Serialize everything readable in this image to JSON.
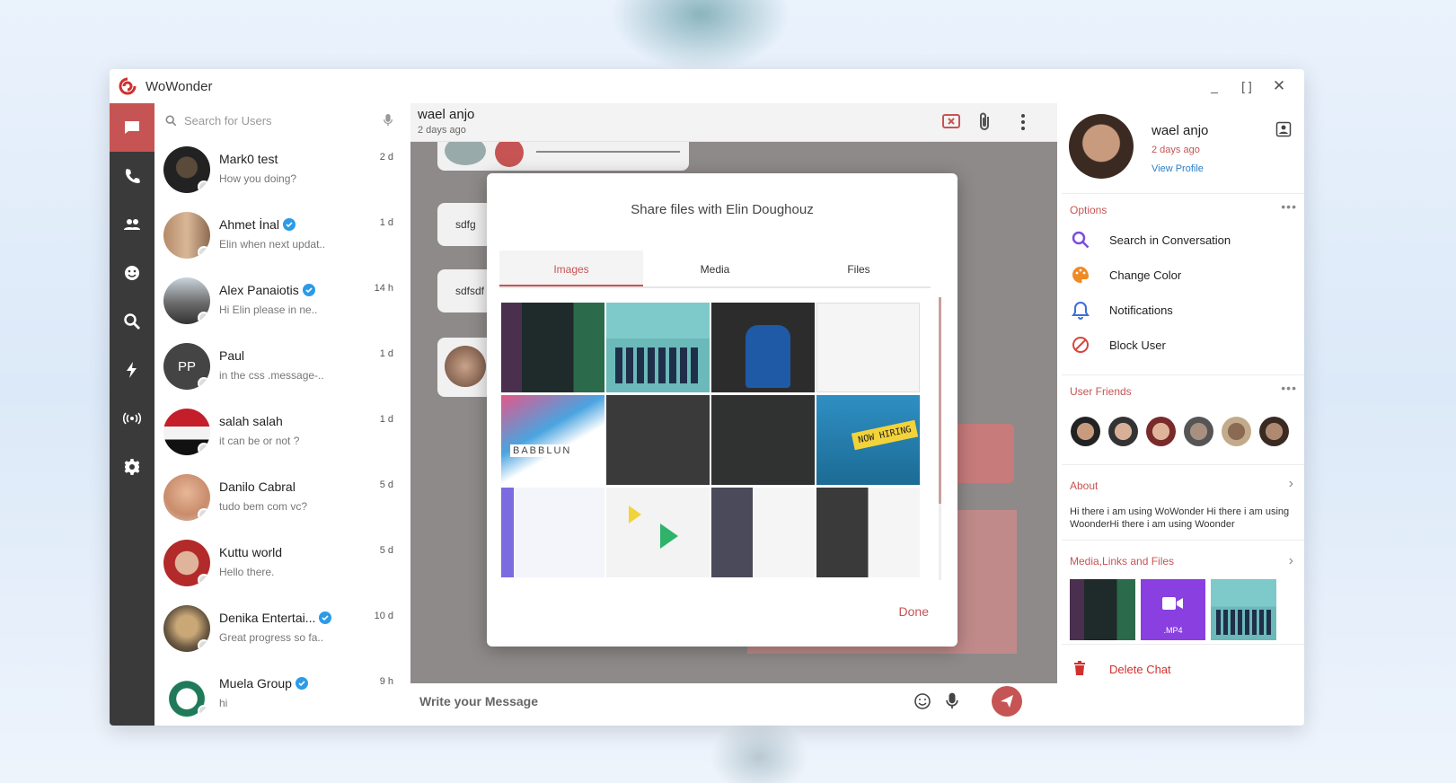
{
  "window": {
    "title": "WoWonder"
  },
  "sidebar_rail": {
    "items": [
      "chats",
      "calls",
      "groups",
      "stickers",
      "search",
      "stories",
      "broadcast",
      "settings"
    ]
  },
  "search": {
    "placeholder": "Search for Users"
  },
  "chats": [
    {
      "name": "Mark0 test",
      "preview": "How you doing?",
      "time": "2 d",
      "verified": false
    },
    {
      "name": "Ahmet İnal",
      "preview": "Elin when next updat..",
      "time": "1 d",
      "verified": true
    },
    {
      "name": "Alex Panaiotis",
      "preview": "Hi Elin please in ne..",
      "time": "14 h",
      "verified": true
    },
    {
      "name": "Paul",
      "preview": "in the css .message-..",
      "time": "1 d",
      "verified": false,
      "initials": "PP"
    },
    {
      "name": "salah salah",
      "preview": "it can be or not ?",
      "time": "1 d",
      "verified": false
    },
    {
      "name": "Danilo Cabral",
      "preview": "tudo bem com vc?",
      "time": "5 d",
      "verified": false
    },
    {
      "name": "Kuttu world",
      "preview": "Hello there.",
      "time": "5 d",
      "verified": false
    },
    {
      "name": "Denika Entertai...",
      "preview": "Great progress so fa..",
      "time": "10 d",
      "verified": true
    },
    {
      "name": "Muela Group",
      "preview": "hi",
      "time": "9 h",
      "verified": true
    }
  ],
  "conversation": {
    "name": "wael anjo",
    "status": "2 days ago",
    "bubbles": [
      "sdfg",
      "sdfsdf"
    ],
    "composer_placeholder": "Write your Message"
  },
  "share_modal": {
    "title": "Share files with  Elin Doughouz",
    "tabs": [
      "Images",
      "Media",
      "Files"
    ],
    "active_tab": "Images",
    "done_label": "Done",
    "thumb_texts": {
      "babblon": "BABBLUN",
      "hiring": "NOW HIRING"
    }
  },
  "profile": {
    "name": "wael anjo",
    "status": "2 days ago",
    "view_profile": "View Profile"
  },
  "options": {
    "title": "Options",
    "items": [
      {
        "label": "Search in Conversation",
        "icon": "search-icon"
      },
      {
        "label": "Change Color",
        "icon": "palette-icon"
      },
      {
        "label": "Notifications",
        "icon": "bell-icon"
      },
      {
        "label": "Block User",
        "icon": "block-icon"
      }
    ]
  },
  "friends": {
    "title": "User Friends",
    "count_shown": 6
  },
  "about": {
    "title": "About",
    "text": "Hi there i am using WoWonder Hi there i am using WoonderHi there i am using Woonder"
  },
  "media": {
    "title": "Media,Links and Files",
    "video_label": ".MP4"
  },
  "delete_chat": {
    "label": "Delete Chat"
  },
  "colors": {
    "accent": "#c75454",
    "rail": "#3a3a3a",
    "link": "#2a7fc8",
    "icon_blue": "#3b6fd8",
    "icon_orange": "#f08a24",
    "icon_purple": "#7c4ddb"
  }
}
